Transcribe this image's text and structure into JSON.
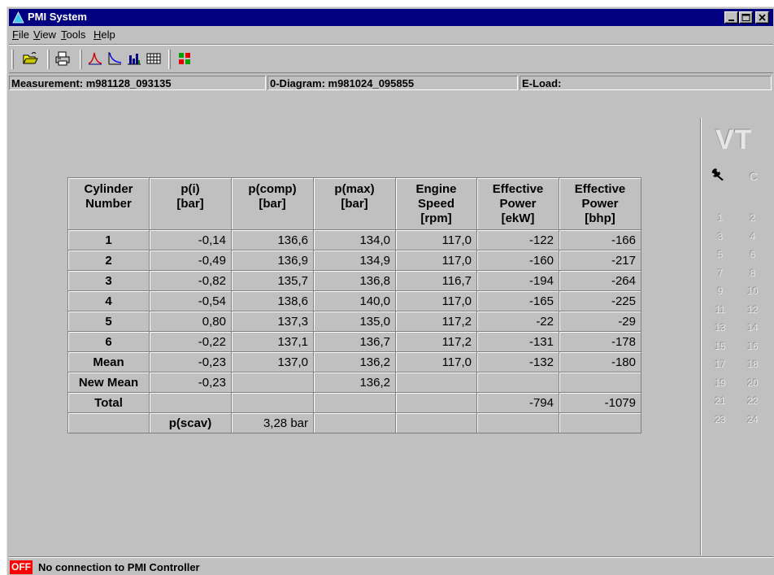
{
  "window": {
    "title": "PMI System"
  },
  "menu": [
    {
      "label": "File",
      "key": "F",
      "rest": "ile"
    },
    {
      "label": "View",
      "key": "V",
      "rest": "iew"
    },
    {
      "label": "Tools",
      "key": "T",
      "rest": "ools"
    },
    {
      "label": "Help",
      "key": "H",
      "rest": "elp"
    }
  ],
  "toolbar": {
    "icons": [
      "open-folder-icon",
      "print-icon",
      "pressure-curve-icon",
      "compression-curve-icon",
      "bar-chart-icon",
      "table-view-icon",
      "colored-grid-icon"
    ]
  },
  "info": {
    "measurement": "Measurement: m981128_093135",
    "diagram": "0-Diagram: m981024_095855",
    "eload": "E-Load:"
  },
  "table": {
    "headers": [
      [
        "Cylinder",
        "Number"
      ],
      [
        "p(i)",
        "[bar]"
      ],
      [
        "p(comp)",
        "[bar]"
      ],
      [
        "p(max)",
        "[bar]"
      ],
      [
        "Engine",
        "Speed",
        "[rpm]"
      ],
      [
        "Effective",
        "Power",
        "[ekW]"
      ],
      [
        "Effective",
        "Power",
        "[bhp]"
      ]
    ],
    "rows": [
      [
        "1",
        "-0,14",
        "136,6",
        "134,0",
        "117,0",
        "-122",
        "-166"
      ],
      [
        "2",
        "-0,49",
        "136,9",
        "134,9",
        "117,0",
        "-160",
        "-217"
      ],
      [
        "3",
        "-0,82",
        "135,7",
        "136,8",
        "116,7",
        "-194",
        "-264"
      ],
      [
        "4",
        "-0,54",
        "138,6",
        "140,0",
        "117,0",
        "-165",
        "-225"
      ],
      [
        "5",
        "0,80",
        "137,3",
        "135,0",
        "117,2",
        "-22",
        "-29"
      ],
      [
        "6",
        "-0,22",
        "137,1",
        "136,7",
        "117,2",
        "-131",
        "-178"
      ],
      [
        "Mean",
        "-0,23",
        "137,0",
        "136,2",
        "117,0",
        "-132",
        "-180"
      ],
      [
        "New Mean",
        "-0,23",
        "",
        "136,2",
        "",
        "",
        ""
      ],
      [
        "Total",
        "",
        "",
        "",
        "",
        "-794",
        "-1079"
      ],
      [
        "",
        "p(scav)",
        "3,28 bar",
        "",
        "",
        "",
        ""
      ]
    ]
  },
  "side_panel": {
    "logo": "VT",
    "c_label": "C",
    "cylinders": [
      "1",
      "2",
      "3",
      "4",
      "5",
      "6",
      "7",
      "8",
      "9",
      "10",
      "11",
      "12",
      "13",
      "14",
      "15",
      "16",
      "17",
      "18",
      "19",
      "20",
      "21",
      "22",
      "23",
      "24"
    ]
  },
  "status": {
    "badge": "OFF",
    "badge_color": "#ff0000",
    "text": "No connection to PMI Controller"
  },
  "colors": {
    "titlebar": "#000080",
    "face": "#c0c0c0"
  }
}
